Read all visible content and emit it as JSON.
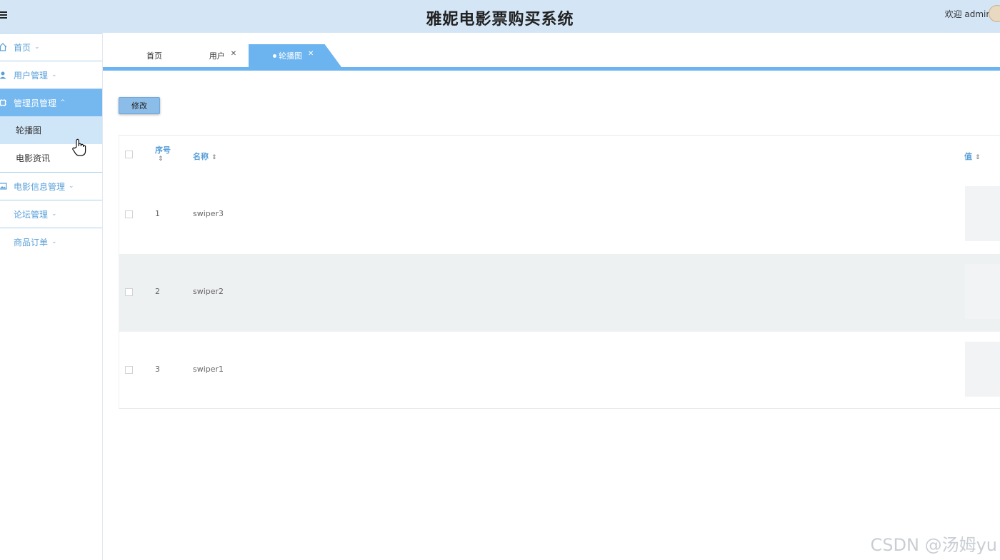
{
  "header": {
    "title": "雅妮电影票购买系统",
    "welcome": "欢迎 admin"
  },
  "sidebar": {
    "items": [
      {
        "label": "首页"
      },
      {
        "label": "用户管理"
      },
      {
        "label": "管理员管理",
        "children": [
          {
            "label": "轮播图"
          },
          {
            "label": "电影资讯"
          }
        ]
      },
      {
        "label": "电影信息管理"
      },
      {
        "label": "论坛管理"
      },
      {
        "label": "商品订单"
      }
    ]
  },
  "tabs": [
    {
      "label": "首页"
    },
    {
      "label": "用户"
    },
    {
      "label": "轮播图"
    }
  ],
  "toolbar": {
    "edit_label": "修改"
  },
  "table": {
    "columns": [
      "序号",
      "名称",
      "值"
    ],
    "rows": [
      {
        "index": "1",
        "name": "swiper3"
      },
      {
        "index": "2",
        "name": "swiper2"
      },
      {
        "index": "3",
        "name": "swiper1"
      }
    ]
  },
  "watermark": "CSDN @汤姆yu",
  "colors": {
    "header_bg": "#d4e6f6",
    "accent": "#6cb4ef",
    "active_menu": "#74b8ef"
  }
}
